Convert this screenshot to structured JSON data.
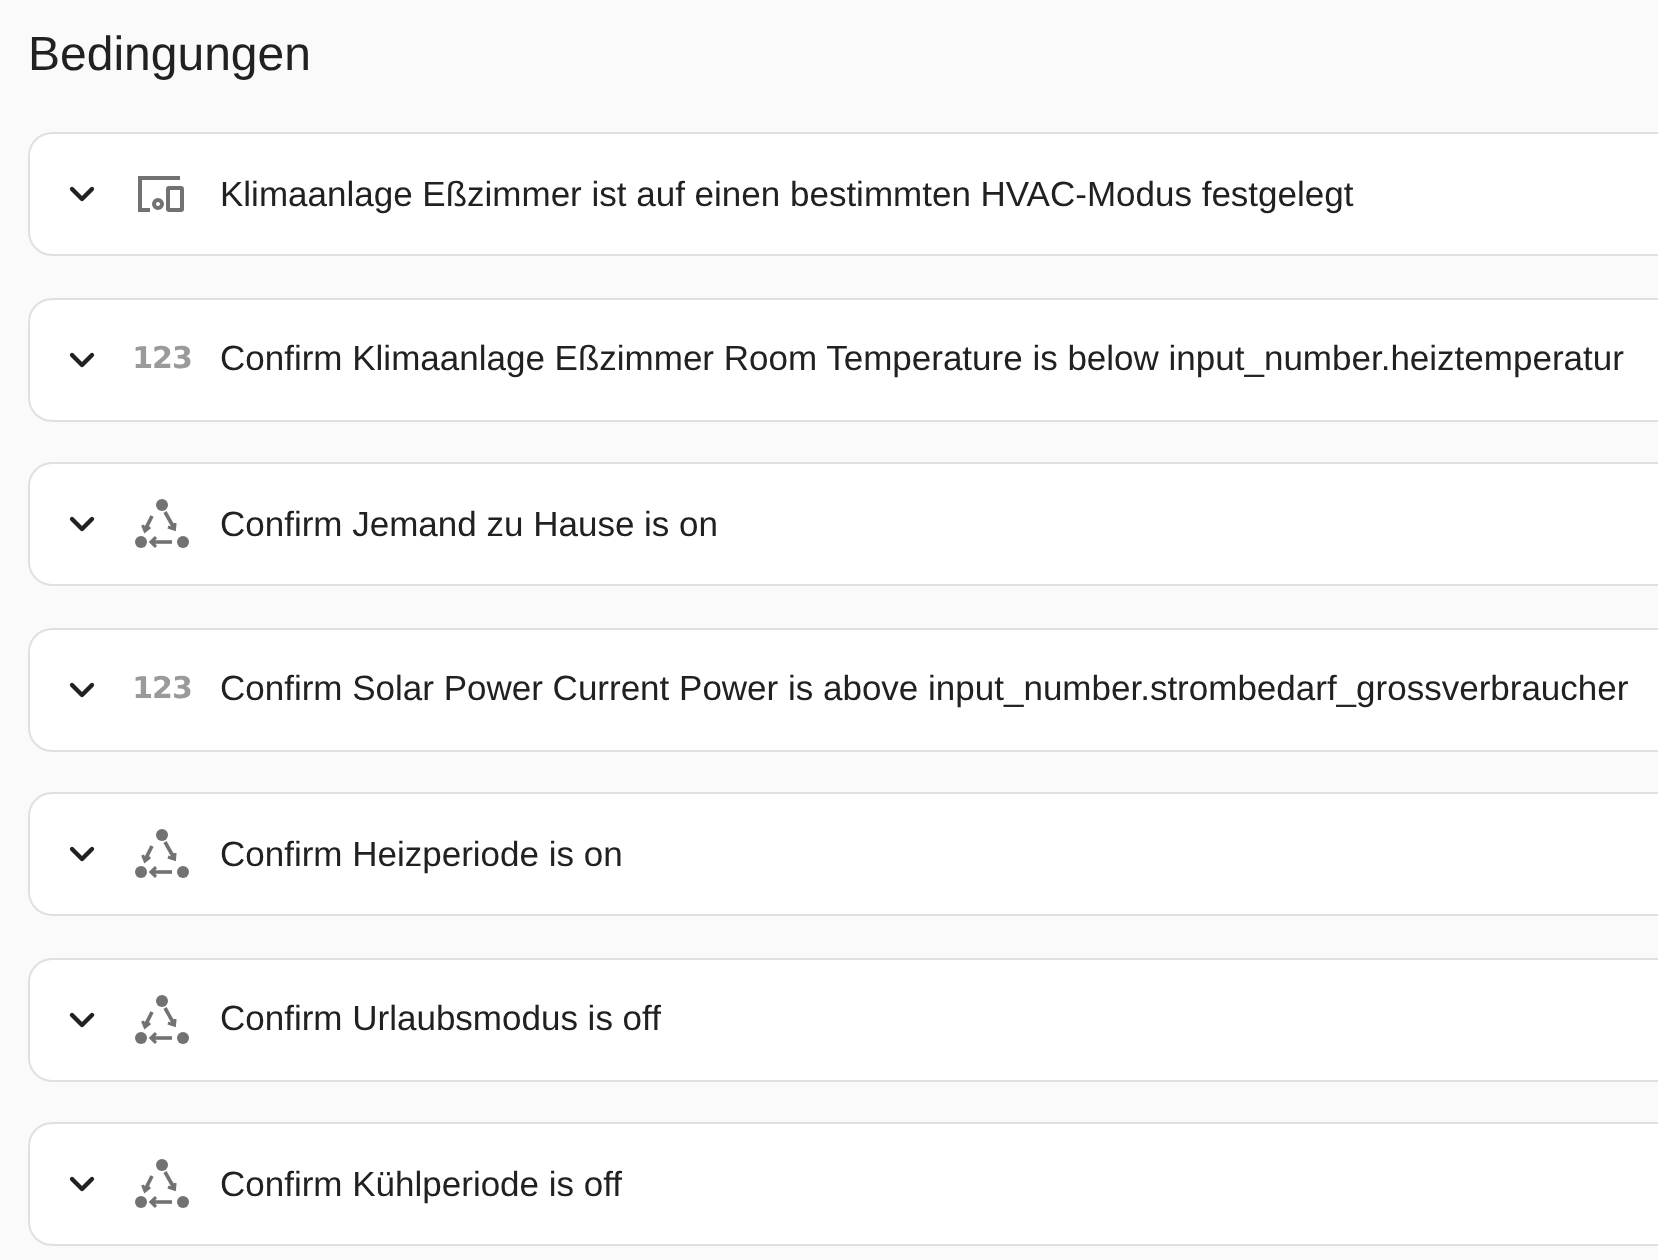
{
  "title": "Bedingungen",
  "conditions": [
    {
      "kind": "device",
      "expanded": false,
      "label": "Klimaanlage Eßzimmer ist auf einen bestimmten HVAC-Modus festgelegt"
    },
    {
      "kind": "numeric",
      "icon_text": "123",
      "expanded": false,
      "label": "Confirm Klimaanlage Eßzimmer Room Temperature is below input_number.heiztemperatur"
    },
    {
      "kind": "state",
      "expanded": false,
      "label": "Confirm Jemand zu Hause is on"
    },
    {
      "kind": "numeric",
      "icon_text": "123",
      "expanded": false,
      "label": "Confirm Solar Power Current Power is above input_number.strombedarf_grossverbraucher"
    },
    {
      "kind": "state",
      "expanded": false,
      "label": "Confirm Heizperiode is on"
    },
    {
      "kind": "state",
      "expanded": false,
      "label": "Confirm Urlaubsmodus is off"
    },
    {
      "kind": "state",
      "expanded": false,
      "label": "Confirm Kühlperiode is off"
    }
  ]
}
